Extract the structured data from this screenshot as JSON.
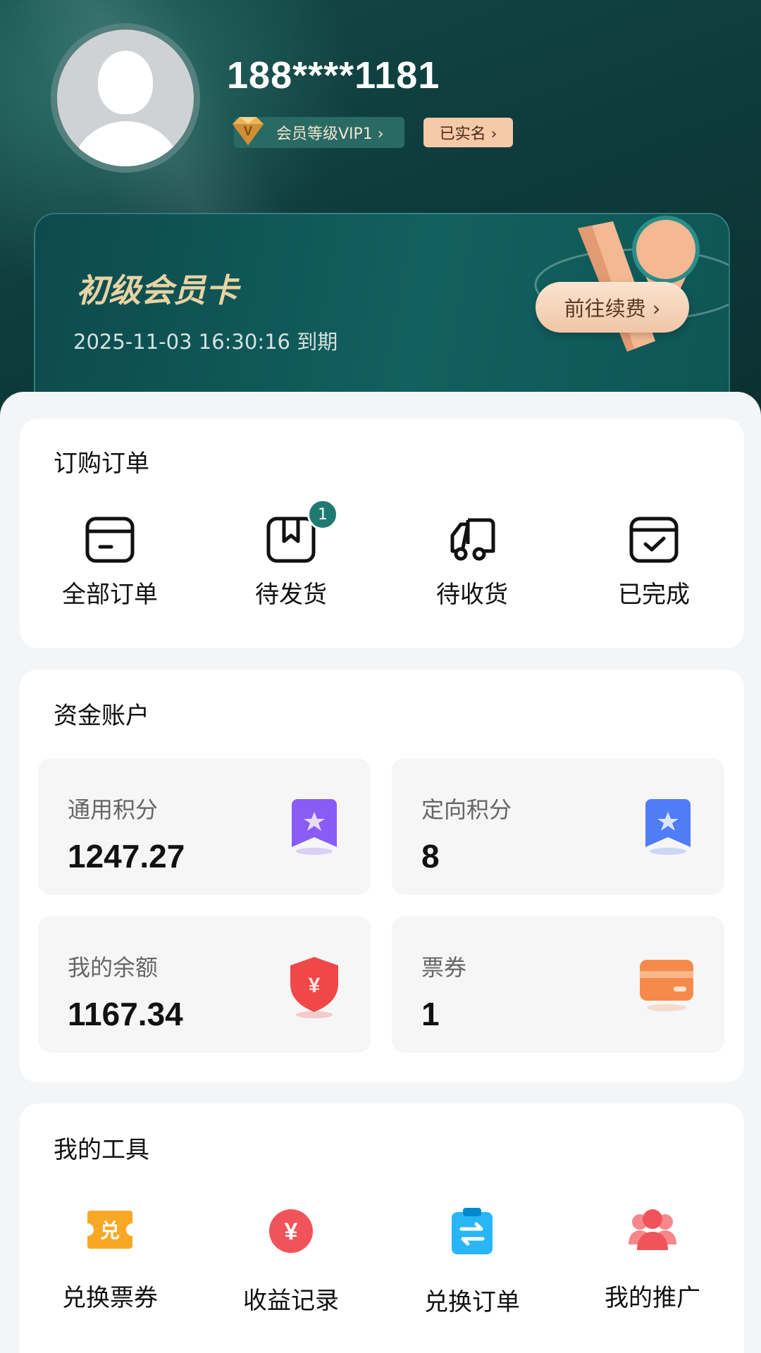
{
  "profile": {
    "phone": "188****1181",
    "vip_label": "会员等级VIP1 ›",
    "verified_label": "已实名 ›"
  },
  "member_card": {
    "title": "初级会员卡",
    "expire": "2025-11-03 16:30:16 到期",
    "renew_label": "前往续费 ›"
  },
  "orders": {
    "title": "订购订单",
    "items": [
      {
        "label": "全部订单",
        "icon": "order-box-icon"
      },
      {
        "label": "待发货",
        "icon": "package-icon",
        "badge": "1"
      },
      {
        "label": "待收货",
        "icon": "truck-icon"
      },
      {
        "label": "已完成",
        "icon": "check-box-icon"
      }
    ]
  },
  "funds": {
    "title": "资金账户",
    "items": [
      {
        "label": "通用积分",
        "value": "1247.27",
        "icon": "purple-ribbon-star-icon",
        "color": "#8a5cf6"
      },
      {
        "label": "定向积分",
        "value": "8",
        "icon": "blue-ribbon-star-icon",
        "color": "#4f7cf7"
      },
      {
        "label": "我的余额",
        "value": "1167.34",
        "icon": "yuan-shield-icon",
        "color": "#f04848"
      },
      {
        "label": "票券",
        "value": "1",
        "icon": "card-icon",
        "color": "#f58a4a"
      }
    ]
  },
  "tools": {
    "title": "我的工具",
    "items": [
      {
        "label": "兑换票券",
        "icon": "exchange-ticket-icon",
        "glyph": "兑",
        "color": "#f9a825"
      },
      {
        "label": "收益记录",
        "icon": "yuan-coin-icon",
        "glyph": "¥",
        "color": "#f0545a"
      },
      {
        "label": "兑换订单",
        "icon": "exchange-order-icon",
        "color": "#29b6f6"
      },
      {
        "label": "我的推广",
        "icon": "users-icon",
        "color": "#f0545a"
      }
    ]
  }
}
